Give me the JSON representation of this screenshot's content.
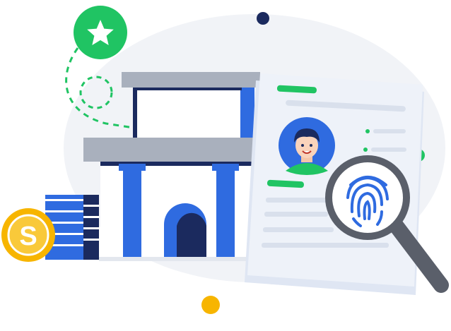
{
  "illustration": {
    "coin_symbol": "S",
    "icons": {
      "star_badge": "star-icon",
      "coin": "dollar-coin-icon",
      "building": "bank-building-icon",
      "document": "profile-document-icon",
      "avatar": "user-avatar-icon",
      "magnifier": "magnifying-glass-icon",
      "fingerprint": "fingerprint-icon"
    },
    "colors": {
      "blue": "#2f6be0",
      "dark_navy": "#1b2a5e",
      "green": "#20c463",
      "gold": "#f7b500",
      "gray": "#a9b0bd",
      "light_bg": "#f1f3f7",
      "paper": "#eef2f9",
      "white": "#ffffff"
    }
  }
}
